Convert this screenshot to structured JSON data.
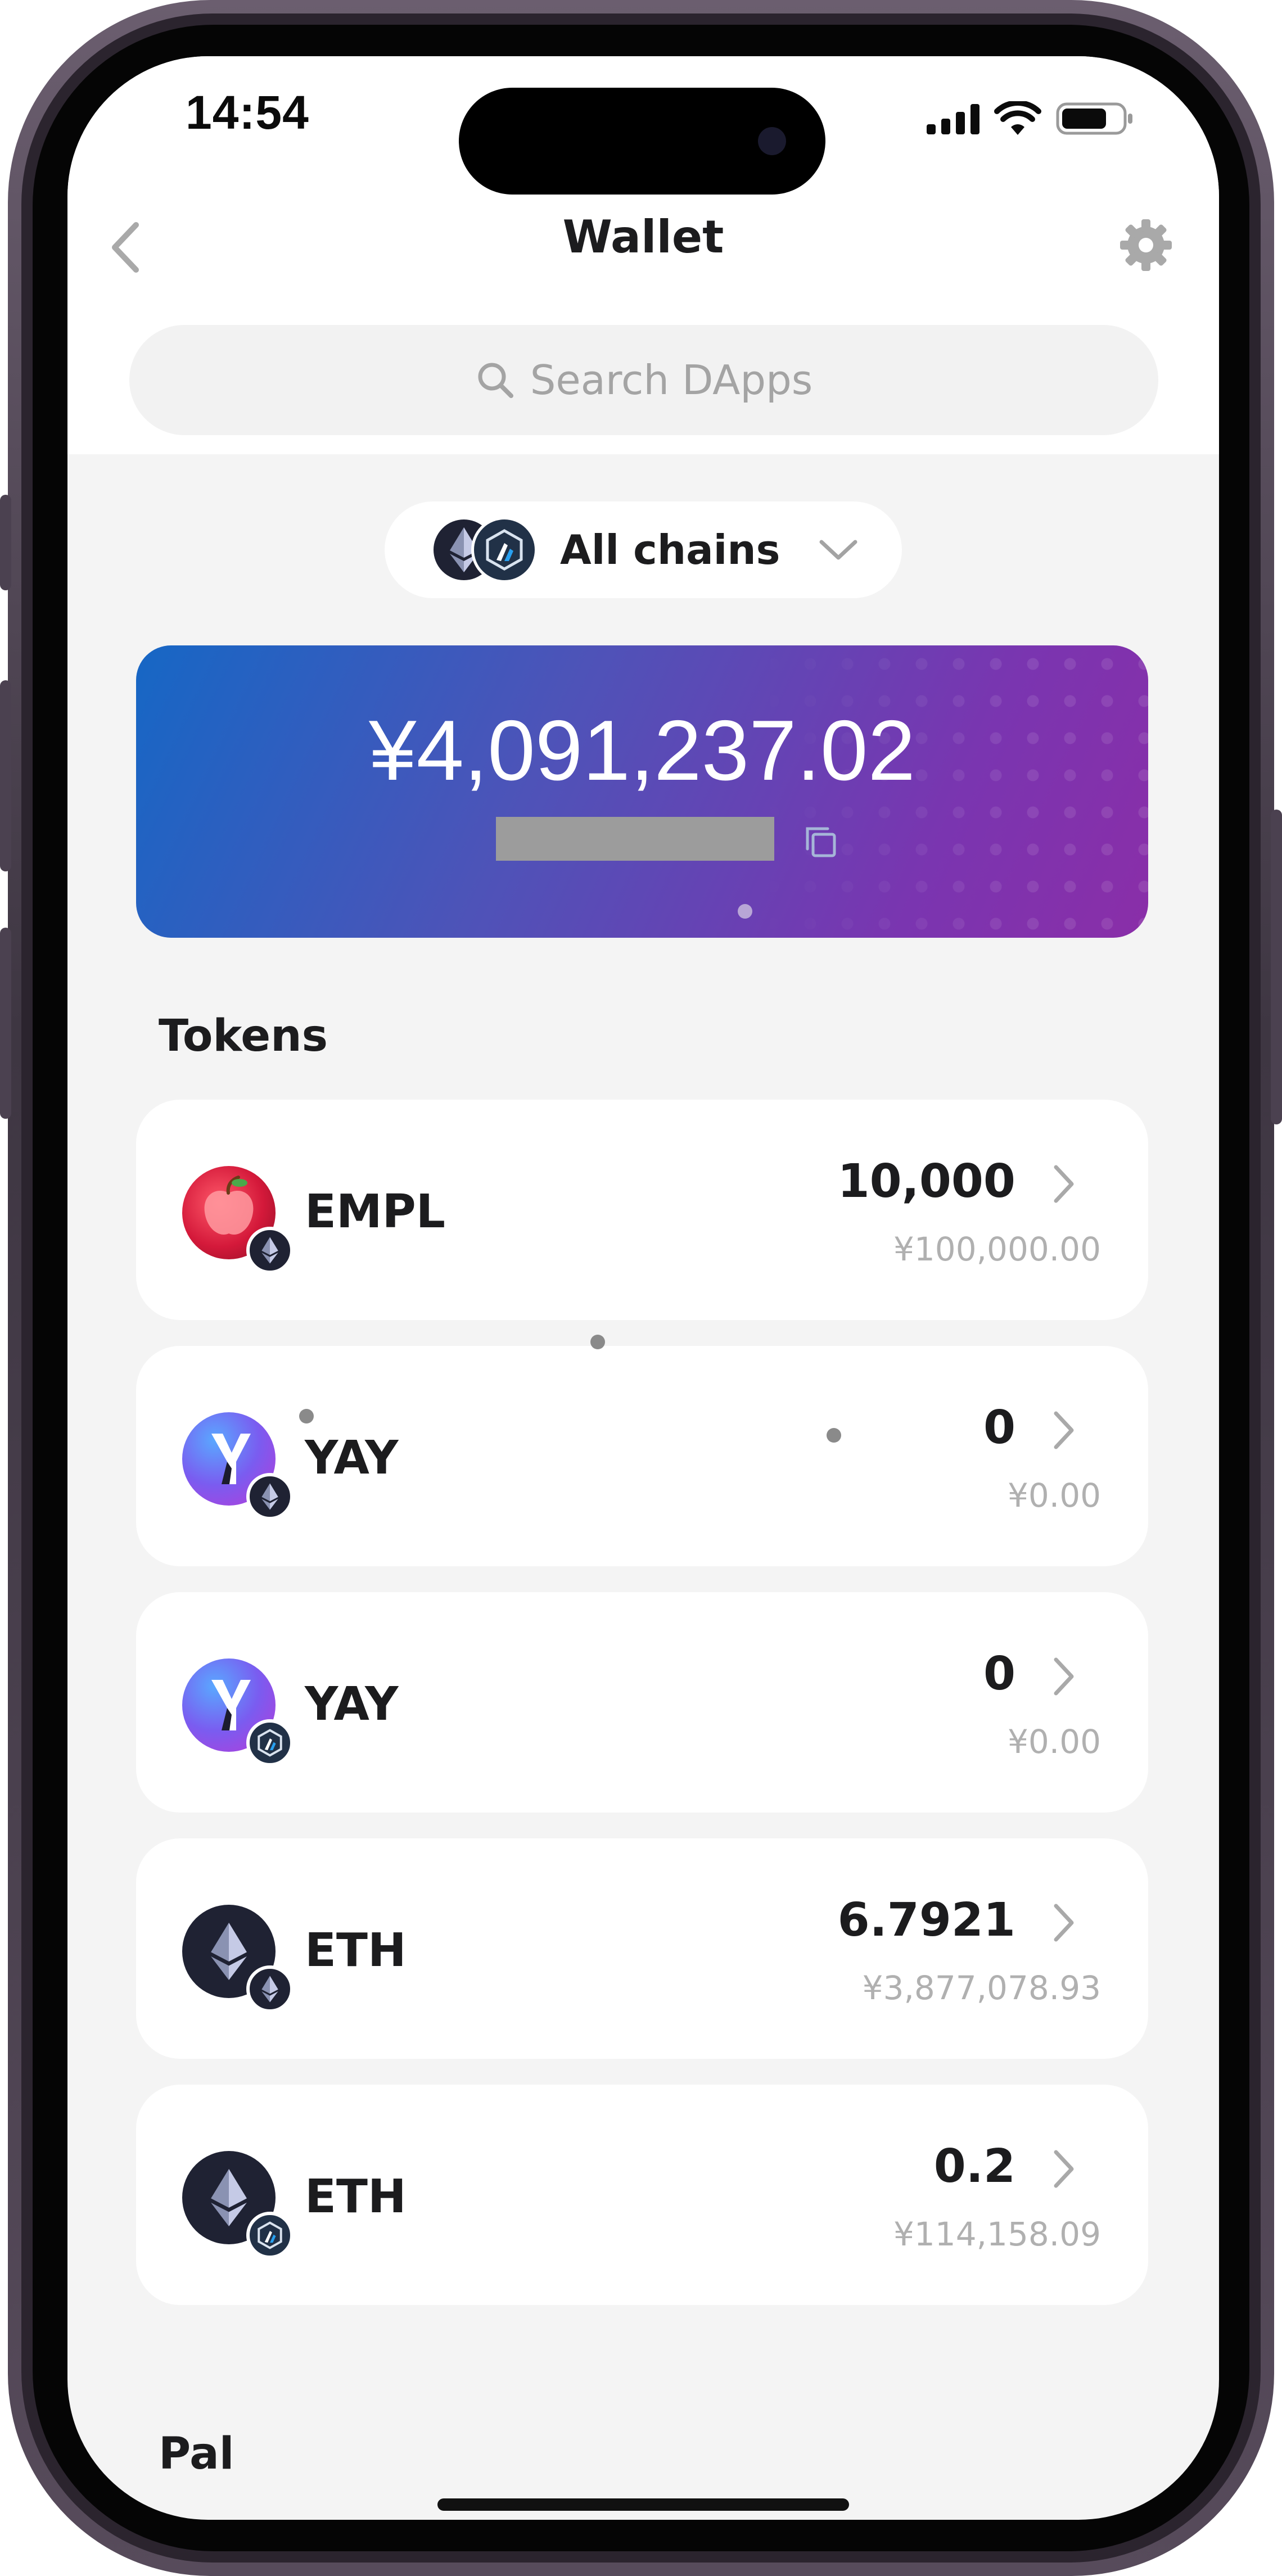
{
  "status_bar": {
    "time": "14:54",
    "icons": [
      "cellular-signal-icon",
      "wifi-icon",
      "battery-icon"
    ]
  },
  "nav": {
    "title": "Wallet",
    "back_icon": "chevron-left-icon",
    "settings_icon": "gear-icon"
  },
  "search": {
    "placeholder": "Search DApps",
    "icon": "search-icon"
  },
  "chain_selector": {
    "label": "All chains",
    "icons": [
      "ethereum-icon",
      "arbitrum-icon"
    ]
  },
  "balance_card": {
    "amount": "¥4,091,237.02",
    "copy_icon": "copy-icon"
  },
  "tokens_section": {
    "title": "Tokens",
    "items": [
      {
        "symbol": "EMPL",
        "amount": "10,000",
        "value": "¥100,000.00",
        "icon": "empl-apple-icon",
        "chain": "ethereum-icon"
      },
      {
        "symbol": "YAY",
        "amount": "0",
        "value": "¥0.00",
        "icon": "yay-icon",
        "chain": "ethereum-icon"
      },
      {
        "symbol": "YAY",
        "amount": "0",
        "value": "¥0.00",
        "icon": "yay-icon",
        "chain": "arbitrum-icon"
      },
      {
        "symbol": "ETH",
        "amount": "6.7921",
        "value": "¥3,877,078.93",
        "icon": "ethereum-icon",
        "chain": "ethereum-icon"
      },
      {
        "symbol": "ETH",
        "amount": "0.2",
        "value": "¥114,158.09",
        "icon": "ethereum-icon",
        "chain": "arbitrum-icon"
      }
    ]
  },
  "pal_section": {
    "title": "Pal"
  },
  "colors": {
    "card_gradient_start": "#1667c5",
    "card_gradient_end": "#8a2ea8",
    "background": "#f4f4f4",
    "secondary_text": "#b0b0b0"
  }
}
